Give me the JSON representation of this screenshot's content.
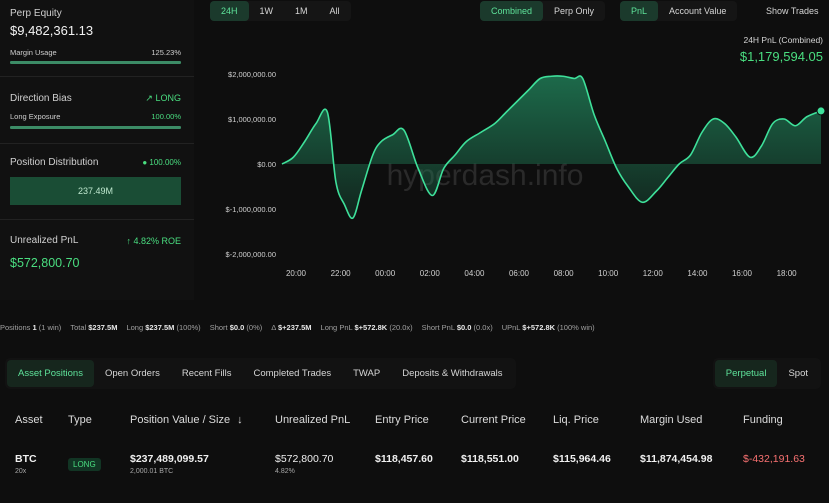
{
  "left": {
    "equity_label": "Perp Equity",
    "equity_value": "$9,482,361.13",
    "margin_label": "Margin Usage",
    "margin_value": "125.23%",
    "bias_label": "Direction Bias",
    "bias_value": "LONG",
    "exposure_label": "Long Exposure",
    "exposure_value": "100.00%",
    "distribution_label": "Position Distribution",
    "distribution_value": "100.00%",
    "distribution_bar": "237.49M",
    "upnl_label": "Unrealized PnL",
    "upnl_roe": "4.82% ROE",
    "upnl_value": "$572,800.70"
  },
  "range_tabs": [
    "24H",
    "1W",
    "1M",
    "All"
  ],
  "mode_tabs": [
    "Combined",
    "Perp Only"
  ],
  "metric_tabs": [
    "PnL",
    "Account Value"
  ],
  "show_trades": "Show Trades",
  "chart_header": {
    "label": "24H PnL (Combined)",
    "value": "$1,179,594.05"
  },
  "watermark": "hyperdash.info",
  "chart_data": {
    "type": "area",
    "y_ticks": [
      "$2,000,000.00",
      "$1,000,000.00",
      "$0.00",
      "$-1,000,000.00",
      "$-2,000,000.00"
    ],
    "ylim": [
      -2000000,
      2000000
    ],
    "x_ticks": [
      "20:00",
      "22:00",
      "00:00",
      "02:00",
      "04:00",
      "06:00",
      "08:00",
      "10:00",
      "12:00",
      "14:00",
      "16:00",
      "18:00"
    ],
    "x": [
      0,
      0.4,
      0.8,
      1.2,
      1.6,
      1.9,
      2.2,
      2.5,
      2.8,
      3.2,
      3.5,
      3.9,
      4.3,
      4.8,
      5.3,
      5.7,
      6.1,
      6.5,
      7.0,
      7.5,
      7.9,
      8.3,
      8.7,
      9.1,
      9.5,
      9.9,
      10.3,
      10.6,
      11.0,
      11.4,
      11.8,
      12.2,
      12.7,
      13.2,
      13.6,
      14.0,
      14.4,
      14.8,
      15.2,
      15.6,
      16.0,
      16.5,
      16.9,
      17.3,
      17.7,
      18.1,
      18.5,
      19.0
    ],
    "y": [
      0,
      150000,
      500000,
      900000,
      1150000,
      -400000,
      -900000,
      -1200000,
      -600000,
      200000,
      500000,
      650000,
      750000,
      -100000,
      -700000,
      -100000,
      200000,
      500000,
      700000,
      900000,
      1150000,
      1400000,
      1650000,
      1900000,
      1950000,
      1950000,
      1900000,
      1900000,
      1100000,
      500000,
      -100000,
      -500000,
      -850000,
      -600000,
      -300000,
      0,
      200000,
      700000,
      1000000,
      900000,
      600000,
      150000,
      400000,
      900000,
      1000000,
      850000,
      1050000,
      1179594
    ]
  },
  "strip": {
    "positions_label": "Positions",
    "positions_count": "1",
    "positions_win": "(1 win)",
    "total_label": "Total",
    "total_value": "$237.5M",
    "long_label": "Long",
    "long_value": "$237.5M",
    "long_pct": "(100%)",
    "short_label": "Short",
    "short_value": "$0.0",
    "short_pct": "(0%)",
    "delta_label": "Δ",
    "delta_value": "$+237.5M",
    "longpnl_label": "Long PnL",
    "longpnl_value": "$+572.8K",
    "longpnl_x": "(20.0x)",
    "shortpnl_label": "Short PnL",
    "shortpnl_value": "$0.0",
    "shortpnl_x": "(0.0x)",
    "upnl_label": "UPnL",
    "upnl_value": "$+572.8K",
    "upnl_pct": "(100% win)"
  },
  "tabs": [
    "Asset Positions",
    "Open Orders",
    "Recent Fills",
    "Completed Trades",
    "TWAP",
    "Deposits & Withdrawals"
  ],
  "market_tabs": [
    "Perpetual",
    "Spot"
  ],
  "table": {
    "headers": [
      "Asset",
      "Type",
      "Position Value / Size",
      "Unrealized PnL",
      "Entry Price",
      "Current Price",
      "Liq. Price",
      "Margin Used",
      "Funding"
    ],
    "sort_arrow": "↓",
    "row": {
      "asset": "BTC",
      "leverage": "20x",
      "type": "LONG",
      "value": "$237,489,099.57",
      "size": "2,000.01 BTC",
      "upnl": "$572,800.70",
      "upnl_pct": "4.82%",
      "entry": "$118,457.60",
      "current": "$118,551.00",
      "liq": "$115,964.46",
      "margin": "$11,874,454.98",
      "funding": "$-432,191.63"
    }
  },
  "colors": {
    "accent": "#4ade80",
    "negative": "#f87171",
    "area": "#1f7a55"
  }
}
